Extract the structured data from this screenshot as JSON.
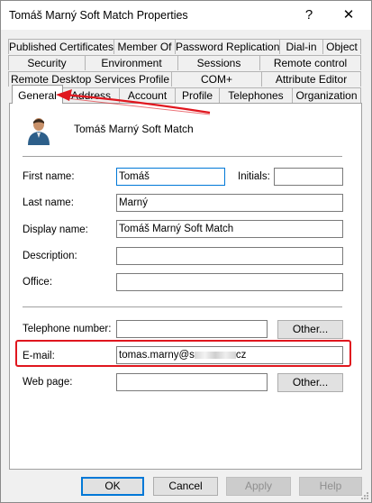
{
  "window": {
    "title": "Tomáš Marný Soft Match Properties",
    "help": "?",
    "close": "✕"
  },
  "tabs": {
    "row1": [
      "Published Certificates",
      "Member Of",
      "Password Replication",
      "Dial-in",
      "Object"
    ],
    "row2": [
      "Security",
      "Environment",
      "Sessions",
      "Remote control"
    ],
    "row3": [
      "Remote Desktop Services Profile",
      "COM+",
      "Attribute Editor"
    ],
    "row4": [
      "General",
      "Address",
      "Account",
      "Profile",
      "Telephones",
      "Organization"
    ]
  },
  "general": {
    "display_header": "Tomáš Marný Soft Match",
    "first_name_label": "First name:",
    "first_name": "Tomáš",
    "initials_label": "Initials:",
    "initials": "",
    "last_name_label": "Last name:",
    "last_name": "Marný",
    "display_name_label": "Display name:",
    "display_name": "Tomáš Marný Soft Match",
    "description_label": "Description:",
    "description": "",
    "office_label": "Office:",
    "office": "",
    "telephone_label": "Telephone number:",
    "telephone": "",
    "email_label": "E-mail:",
    "email_prefix": "tomas.marny@s",
    "email_suffix": "cz",
    "webpage_label": "Web page:",
    "webpage": "",
    "other_label": "Other..."
  },
  "footer": {
    "ok": "OK",
    "cancel": "Cancel",
    "apply": "Apply",
    "help": "Help"
  },
  "colors": {
    "highlight": "#e0161e",
    "focus": "#0078d7"
  }
}
